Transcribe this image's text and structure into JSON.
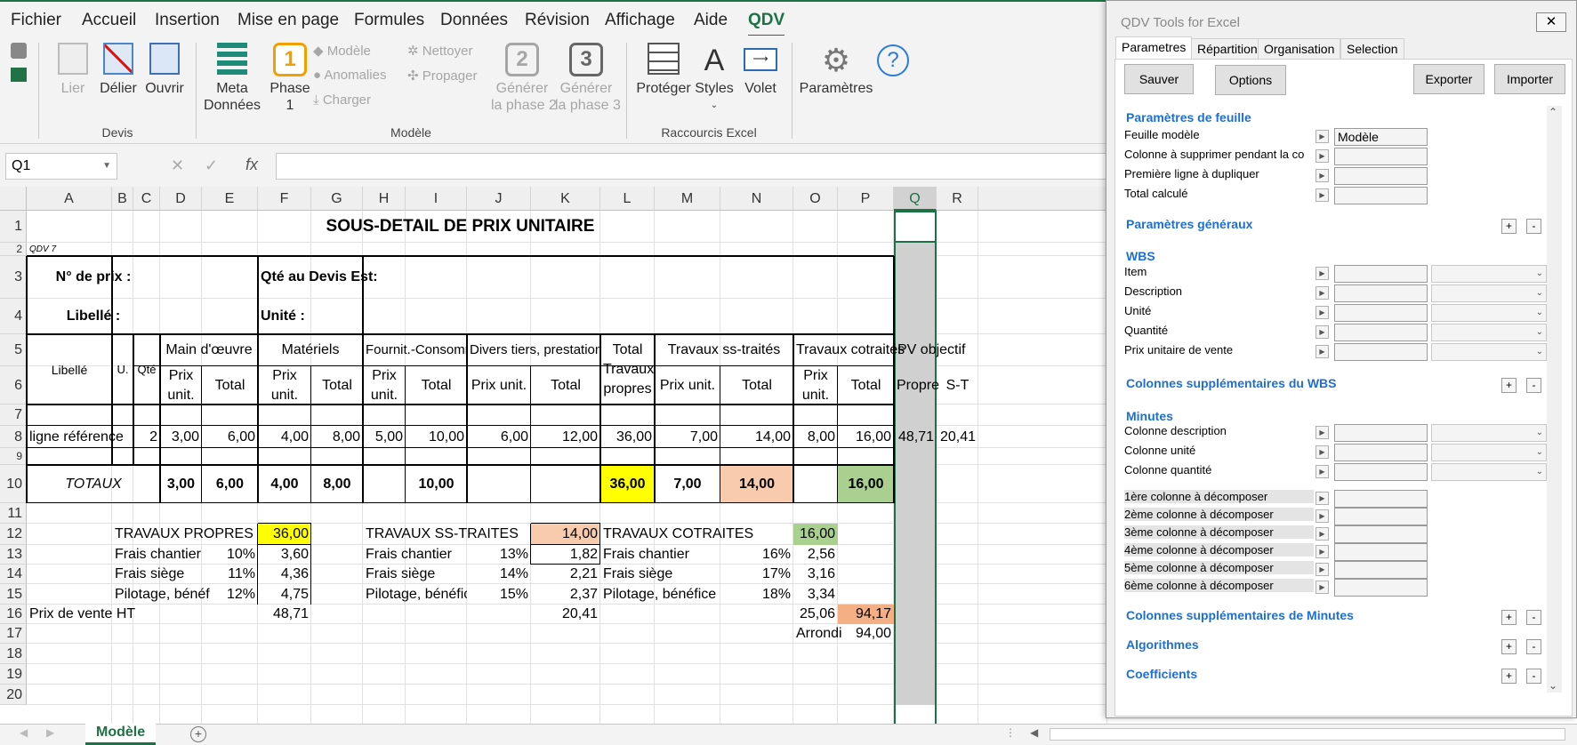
{
  "menu": {
    "items": [
      "Fichier",
      "Accueil",
      "Insertion",
      "Mise en page",
      "Formules",
      "Données",
      "Révision",
      "Affichage",
      "Aide",
      "QDV"
    ],
    "active": "QDV"
  },
  "ribbon": {
    "devis": {
      "lier": "Lier",
      "delier": "Délier",
      "ouvrir": "Ouvrir",
      "group": "Devis"
    },
    "modele": {
      "meta_1": "Meta",
      "meta_2": "Données",
      "phase_num": "1",
      "phase_1": "Phase",
      "phase_2": "1",
      "modele": "Modèle",
      "anomalies": "Anomalies",
      "charger": "Charger",
      "nettoyer": "Nettoyer",
      "propager": "Propager",
      "gen2_num": "2",
      "gen2_1": "Générer",
      "gen2_2": "la phase 2",
      "gen3_num": "3",
      "gen3_1": "Générer",
      "gen3_2": "la phase 3",
      "group": "Modèle"
    },
    "raccourcis": {
      "proteger": "Protéger",
      "styles": "Styles",
      "volet": "Volet",
      "group": "Raccourcis Excel"
    },
    "parametres": "Paramètres"
  },
  "formula_bar": {
    "name_box": "Q1",
    "formula": ""
  },
  "columns": [
    "A",
    "B",
    "C",
    "D",
    "E",
    "F",
    "G",
    "H",
    "I",
    "J",
    "K",
    "L",
    "M",
    "N",
    "O",
    "P",
    "Q",
    "R"
  ],
  "rows": [
    "1",
    "2",
    "3",
    "4",
    "5",
    "6",
    "7",
    "8",
    "9",
    "10",
    "11",
    "12",
    "13",
    "14",
    "15",
    "16",
    "17",
    "18",
    "19",
    "20"
  ],
  "sheet": {
    "title": "SOUS-DETAIL DE PRIX UNITAIRE",
    "qdv": "QDV 7",
    "no_prix": "N° de prix :",
    "qte_devis": "Qté au Devis Est:",
    "libelle_lbl": "Libellé :",
    "unite_lbl": "Unité :",
    "headers": {
      "libelle": "Libellé",
      "u": "U.",
      "qte": "Qté",
      "main_oeuvre": "Main d'œuvre",
      "materiels": "Matériels",
      "fournit": "Fournit.-Consomm",
      "divers": "Divers tiers, prestations",
      "total_1": "Total",
      "total_2": "Travaux",
      "total_3": "propres",
      "ss_traites": "Travaux ss-traités",
      "cotraites": "Travaux cotraités",
      "pv_objectif": "PV objectif",
      "prix_1": "Prix",
      "prix_2": "unit.",
      "total": "Total",
      "prix_unit": "Prix unit.",
      "propre": "Propre",
      "st": "S-T"
    },
    "row8": [
      "ligne référence",
      "2",
      "3,00",
      "6,00",
      "4,00",
      "8,00",
      "5,00",
      "10,00",
      "6,00",
      "12,00",
      "36,00",
      "7,00",
      "14,00",
      "8,00",
      "16,00",
      "48,71",
      "20,41"
    ],
    "totaux": {
      "label": "TOTAUX",
      "d": "3,00",
      "e": "6,00",
      "f": "4,00",
      "g": "8,00",
      "i": "10,00",
      "l": "36,00",
      "m": "7,00",
      "n": "14,00",
      "p": "16,00"
    },
    "summary": {
      "tp_label": "TRAVAUX PROPRES",
      "tp_value": "36,00",
      "st_label": "TRAVAUX SS-TRAITES",
      "st_value": "14,00",
      "ct_label": "TRAVAUX COTRAITES",
      "ct_value": "16,00",
      "frais_chantier": "Frais chantier",
      "frais_siege": "Frais siège",
      "pilotage_1": "Pilotage, bénéf",
      "pilotage_2": "Pilotage, bénéfice",
      "tp_pct": [
        "10%",
        "11%",
        "12%"
      ],
      "tp_vals": [
        "3,60",
        "4,36",
        "4,75"
      ],
      "st_pct": [
        "13%",
        "14%",
        "15%"
      ],
      "st_vals": [
        "1,82",
        "2,21",
        "2,37"
      ],
      "ct_pct": [
        "16%",
        "17%",
        "18%"
      ],
      "ct_vals": [
        "2,56",
        "3,16",
        "3,34"
      ],
      "pv_label": "Prix de vente HT",
      "pv_tp": "48,71",
      "pv_st": "20,41",
      "pv_ct": "25,06",
      "pv_total": "94,17",
      "arrondi_label": "Arrondi",
      "arrondi": "94,00"
    }
  },
  "sheet_tab": "Modèle",
  "panel": {
    "title": "QDV Tools for Excel",
    "tabs": [
      "Parametres",
      "Répartition",
      "Organisation",
      "Selection"
    ],
    "buttons": {
      "sauver": "Sauver",
      "options": "Options",
      "exporter": "Exporter",
      "importer": "Importer"
    },
    "sec_feuille": "Paramètres de feuille",
    "feuille_modele": "Feuille modèle",
    "feuille_modele_val": "Modèle",
    "col_supprimer": "Colonne à supprimer pendant la co",
    "premiere_ligne": "Première ligne à dupliquer",
    "total_calcule": "Total calculé",
    "sec_generaux": "Paramètres généraux",
    "sec_wbs": "WBS",
    "wbs_items": [
      "Item",
      "Description",
      "Unité",
      "Quantité",
      "Prix unitaire de vente"
    ],
    "sec_col_wbs": "Colonnes supplémentaires du WBS",
    "sec_minutes": "Minutes",
    "min_items": [
      "Colonne description",
      "Colonne unité",
      "Colonne quantité"
    ],
    "decomp": [
      "1ère colonne à décomposer",
      "2ème colonne à décomposer",
      "3ème colonne à décomposer",
      "4ème colonne à décomposer",
      "5ème colonne à décomposer",
      "6ème colonne à décomposer"
    ],
    "sec_col_min": "Colonnes supplémentaires de Minutes",
    "sec_algo": "Algorithmes",
    "sec_coef": "Coefficients"
  },
  "colors": {
    "accent": "#1e7145",
    "yellow": "#ffff00",
    "peach": "#f8cbad",
    "green": "#a9d08e",
    "orange": "#f4b084",
    "panel_link": "#1e6fd1"
  }
}
